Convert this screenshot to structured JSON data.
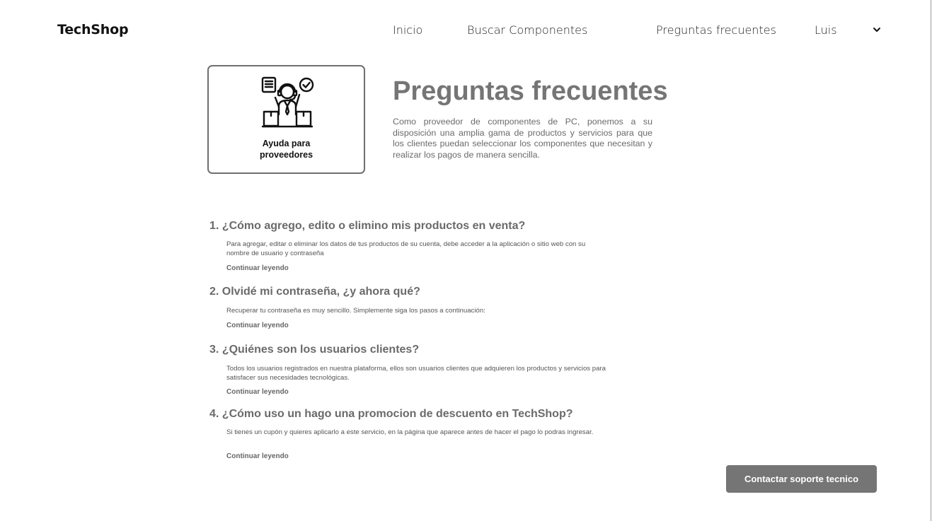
{
  "header": {
    "brand": "TechShop",
    "nav": {
      "home": "Inicio",
      "search": "Buscar Componentes",
      "faq": "Preguntas frecuentes",
      "user": "Luis"
    }
  },
  "help_card": {
    "icon": "support-agent-icon",
    "label_line1": "Ayuda para",
    "label_line2": "proveedores"
  },
  "main": {
    "title": "Preguntas frecuentes",
    "intro": "Como proveedor de componentes de PC, ponemos a su disposición una amplia gama de productos y servicios para que los clientes puedan seleccionar los componentes que necesitan y realizar los pagos de manera sencilla."
  },
  "faqs": [
    {
      "question": "1. ¿Cómo agrego, edito o elimino mis productos en venta?",
      "answer": "Para agregar, editar o eliminar los datos de tus productos de su cuenta, debe acceder a la aplicación o sitio web con su nombre de usuario y contraseña",
      "more": "Continuar leyendo"
    },
    {
      "question": "2. Olvidé mi contraseña, ¿y ahora qué?",
      "answer": "Recuperar tu contraseña es muy sencillo. Simplemente siga los pasos a continuación:",
      "more": "Continuar leyendo"
    },
    {
      "question": "3. ¿Quiénes son los usuarios clientes?",
      "answer": "Todos los usuarios registrados en nuestra plataforma, ellos son usuarios clientes que adquieren los productos y servicios para satisfacer sus necesidades tecnológicas.",
      "more": "Continuar leyendo"
    },
    {
      "question": "4. ¿Cómo uso un hago una promocion de descuento en TechShop?",
      "answer": "Si tienes un cupón y quieres aplicarlo a este servicio, en la página que aparece antes de hacer el pago lo podras ingresar.",
      "more": "Continuar leyendo"
    }
  ],
  "support": {
    "label": "Contactar soporte tecnico"
  },
  "colors": {
    "title_gray": "#757575",
    "button_bg": "#757575",
    "card_border": "#6f6f6f"
  }
}
